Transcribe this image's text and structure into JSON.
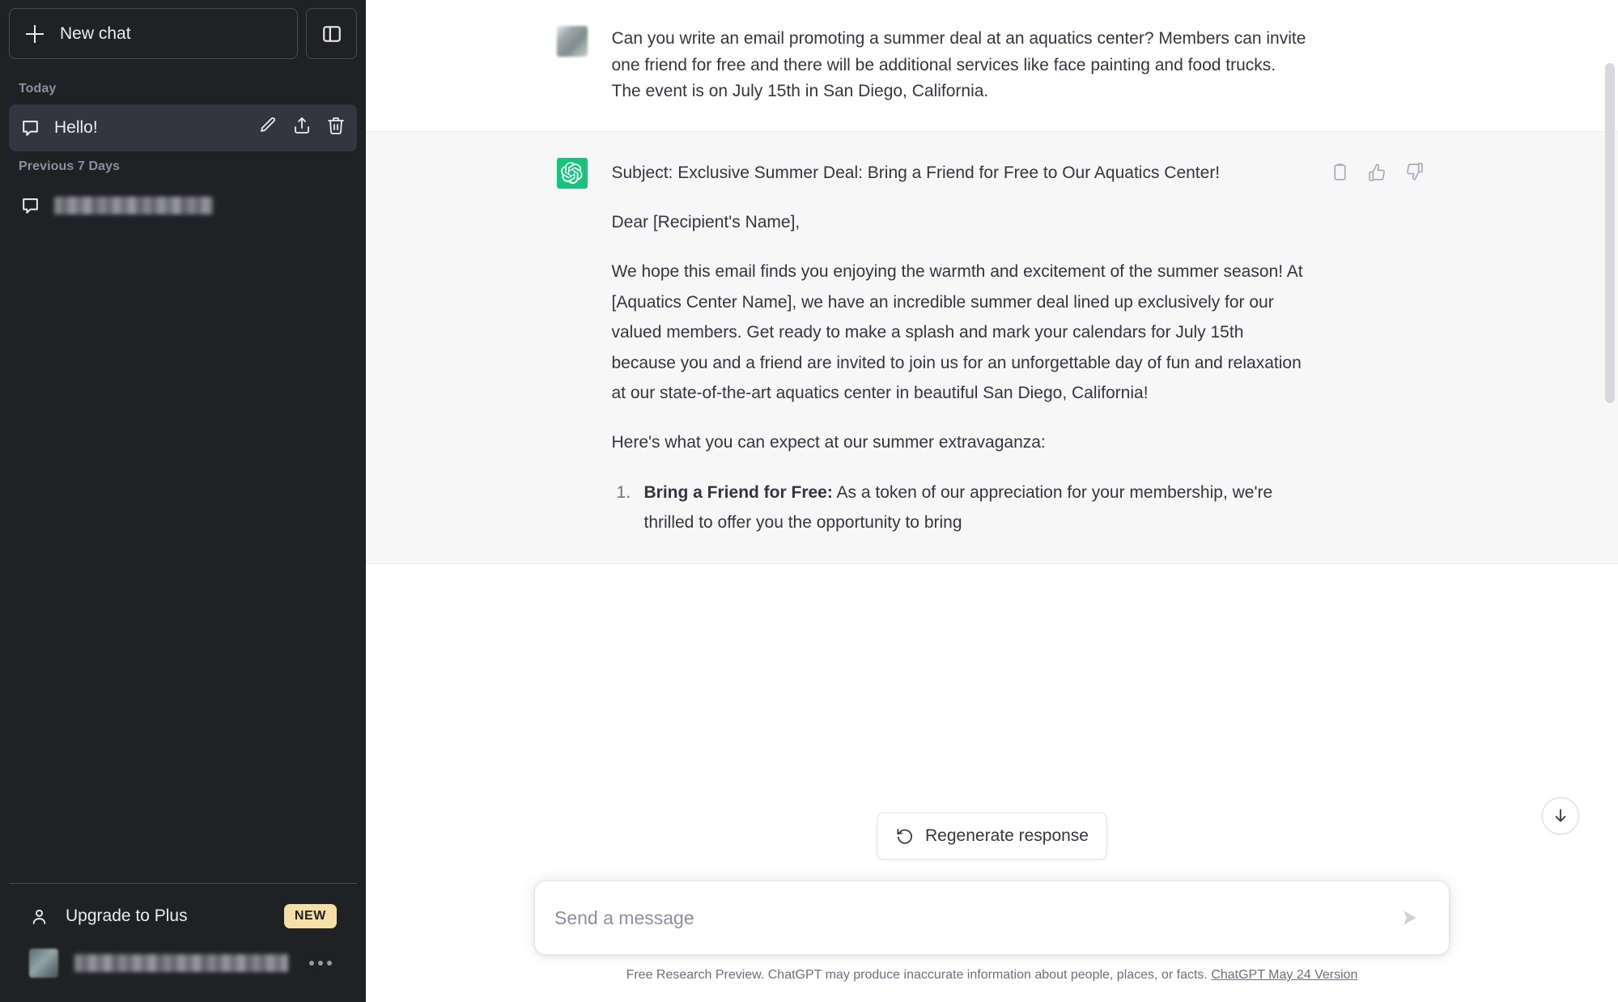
{
  "sidebar": {
    "new_chat_label": "New chat",
    "panel_toggle_icon": "sidebar-panel-icon",
    "sections": [
      {
        "label": "Today"
      },
      {
        "label": "Previous 7 Days"
      }
    ],
    "chats": [
      {
        "title": "Hello!",
        "icon": "chat-bubble-icon",
        "active": true,
        "redacted": false,
        "actions": [
          "edit-icon",
          "share-icon",
          "trash-icon"
        ]
      },
      {
        "title": "",
        "icon": "chat-bubble-icon",
        "active": false,
        "redacted": true,
        "actions": []
      }
    ],
    "upgrade": {
      "label": "Upgrade to Plus",
      "badge": "NEW",
      "icon": "person-icon",
      "badge_color": "#f5dfa6"
    },
    "account": {
      "name": "",
      "redacted": true,
      "menu_icon": "ellipsis-icon"
    }
  },
  "conversation": {
    "messages": [
      {
        "role": "user",
        "avatar": "user-avatar",
        "paragraphs": [
          "Can you write an email promoting a summer deal at an aquatics center? Members can invite one friend for free and there will be additional services like face painting and food trucks. The event is on July 15th in San Diego, California."
        ]
      },
      {
        "role": "assistant",
        "avatar": "chatgpt-logo",
        "avatar_color": "#19c37d",
        "paragraphs": [
          "Subject: Exclusive Summer Deal: Bring a Friend for Free to Our Aquatics Center!",
          "Dear [Recipient's Name],",
          "We hope this email finds you enjoying the warmth and excitement of the summer season! At [Aquatics Center Name], we have an incredible summer deal lined up exclusively for our valued members. Get ready to make a splash and mark your calendars for July 15th because you and a friend are invited to join us for an unforgettable day of fun and relaxation at our state-of-the-art aquatics center in beautiful San Diego, California!",
          "Here's what you can expect at our summer extravaganza:"
        ],
        "list": [
          {
            "number": "1.",
            "title": "Bring a Friend for Free:",
            "text": " As a token of our appreciation for your membership, we're thrilled to offer you the opportunity to bring"
          }
        ],
        "actions": [
          {
            "name": "copy-icon",
            "title": "Copy"
          },
          {
            "name": "thumbs-up-icon",
            "title": "Good response"
          },
          {
            "name": "thumbs-down-icon",
            "title": "Bad response"
          }
        ]
      }
    ]
  },
  "composer": {
    "placeholder": "Send a message",
    "value": "",
    "send_icon": "send-arrow-icon",
    "regenerate_label": "Regenerate response",
    "regenerate_icon": "refresh-icon",
    "scroll_down_icon": "arrow-down-icon"
  },
  "footer": {
    "text": "Free Research Preview. ChatGPT may produce inaccurate information about people, places, or facts.",
    "link": "ChatGPT May 24 Version"
  }
}
